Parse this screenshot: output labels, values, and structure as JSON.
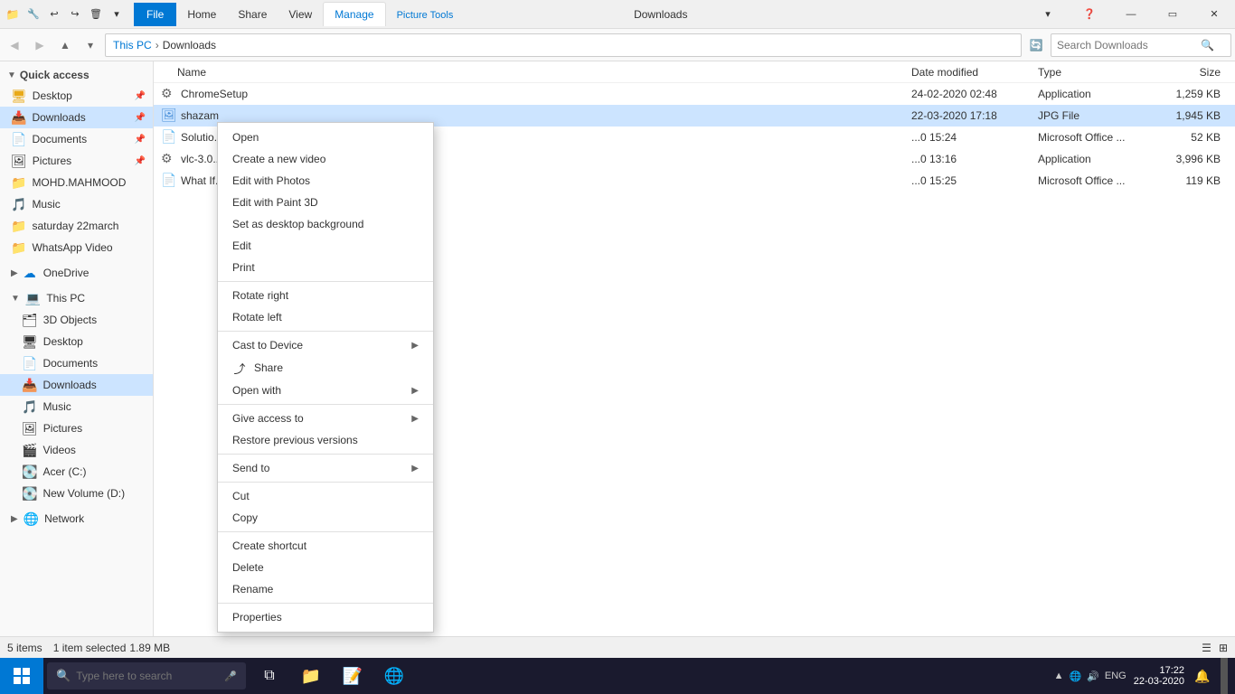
{
  "window": {
    "title": "Downloads",
    "titlebar_title": "Downloads"
  },
  "ribbon": {
    "tabs": [
      "File",
      "Home",
      "Share",
      "View",
      "Manage",
      "Picture Tools"
    ],
    "active_tab": "Manage"
  },
  "addressbar": {
    "path_parts": [
      "This PC",
      "Downloads"
    ],
    "search_placeholder": "Search Downloads"
  },
  "sidebar": {
    "quick_access_label": "Quick access",
    "items_quick": [
      {
        "label": "Desktop",
        "icon": "🖥",
        "pinned": true
      },
      {
        "label": "Downloads",
        "icon": "📥",
        "pinned": true,
        "selected": true
      },
      {
        "label": "Documents",
        "icon": "📄",
        "pinned": true
      },
      {
        "label": "Pictures",
        "icon": "🖼",
        "pinned": true
      }
    ],
    "items_extra": [
      {
        "label": "MOHD.MAHMOOD",
        "icon": "📁"
      },
      {
        "label": "Music",
        "icon": "🎵"
      },
      {
        "label": "saturday 22march",
        "icon": "📁"
      },
      {
        "label": "WhatsApp Video",
        "icon": "📁"
      }
    ],
    "onedrive_label": "OneDrive",
    "this_pc_label": "This PC",
    "this_pc_items": [
      {
        "label": "3D Objects",
        "icon": "🗂"
      },
      {
        "label": "Desktop",
        "icon": "🖥"
      },
      {
        "label": "Documents",
        "icon": "📄"
      },
      {
        "label": "Downloads",
        "icon": "📥"
      },
      {
        "label": "Music",
        "icon": "🎵"
      },
      {
        "label": "Pictures",
        "icon": "🖼"
      },
      {
        "label": "Videos",
        "icon": "🎬"
      },
      {
        "label": "Acer (C:)",
        "icon": "💽"
      },
      {
        "label": "New Volume (D:)",
        "icon": "💽"
      }
    ],
    "network_label": "Network"
  },
  "columns": {
    "name": "Name",
    "date_modified": "Date modified",
    "type": "Type",
    "size": "Size"
  },
  "files": [
    {
      "name": "ChromeSetup",
      "icon": "⚙",
      "type_icon": "app",
      "date": "24-02-2020 02:48",
      "type": "Application",
      "size": "1,259 KB",
      "selected": false
    },
    {
      "name": "shazam",
      "icon": "🖼",
      "type_icon": "jpg",
      "date": "22-03-2020 17:18",
      "type": "JPG File",
      "size": "1,945 KB",
      "selected": true
    },
    {
      "name": "Solutio...",
      "icon": "📄",
      "type_icon": "doc",
      "date": "...0 15:24",
      "type": "Microsoft Office ...",
      "size": "52 KB",
      "selected": false
    },
    {
      "name": "vlc-3.0...",
      "icon": "⚙",
      "type_icon": "app",
      "date": "...0 13:16",
      "type": "Application",
      "size": "3,996 KB",
      "selected": false
    },
    {
      "name": "What If...",
      "icon": "📄",
      "type_icon": "doc",
      "date": "...0 15:25",
      "type": "Microsoft Office ...",
      "size": "119 KB",
      "selected": false
    }
  ],
  "statusbar": {
    "count": "5 items",
    "selected": "1 item selected",
    "size": "1.89 MB"
  },
  "context_menu": {
    "items": [
      {
        "label": "Open",
        "type": "normal"
      },
      {
        "label": "Create a new video",
        "type": "normal"
      },
      {
        "label": "Edit with Photos",
        "type": "normal"
      },
      {
        "label": "Edit with Paint 3D",
        "type": "normal"
      },
      {
        "label": "Set as desktop background",
        "type": "normal"
      },
      {
        "label": "Edit",
        "type": "normal"
      },
      {
        "label": "Print",
        "type": "normal"
      },
      {
        "type": "separator"
      },
      {
        "label": "Rotate right",
        "type": "normal"
      },
      {
        "label": "Rotate left",
        "type": "normal"
      },
      {
        "type": "separator"
      },
      {
        "label": "Cast to Device",
        "type": "submenu"
      },
      {
        "label": "Share",
        "type": "normal",
        "icon": "share"
      },
      {
        "label": "Open with",
        "type": "submenu"
      },
      {
        "type": "separator"
      },
      {
        "label": "Give access to",
        "type": "submenu"
      },
      {
        "label": "Restore previous versions",
        "type": "normal"
      },
      {
        "type": "separator"
      },
      {
        "label": "Send to",
        "type": "submenu"
      },
      {
        "type": "separator"
      },
      {
        "label": "Cut",
        "type": "normal"
      },
      {
        "label": "Copy",
        "type": "normal"
      },
      {
        "type": "separator"
      },
      {
        "label": "Create shortcut",
        "type": "normal"
      },
      {
        "label": "Delete",
        "type": "normal"
      },
      {
        "label": "Rename",
        "type": "normal"
      },
      {
        "type": "separator"
      },
      {
        "label": "Properties",
        "type": "normal"
      }
    ]
  },
  "taskbar": {
    "search_placeholder": "Type here to search",
    "time": "17:22",
    "date": "22-03-2020",
    "lang": "ENG",
    "icons": [
      "taskview",
      "explorer",
      "word",
      "chrome"
    ]
  }
}
